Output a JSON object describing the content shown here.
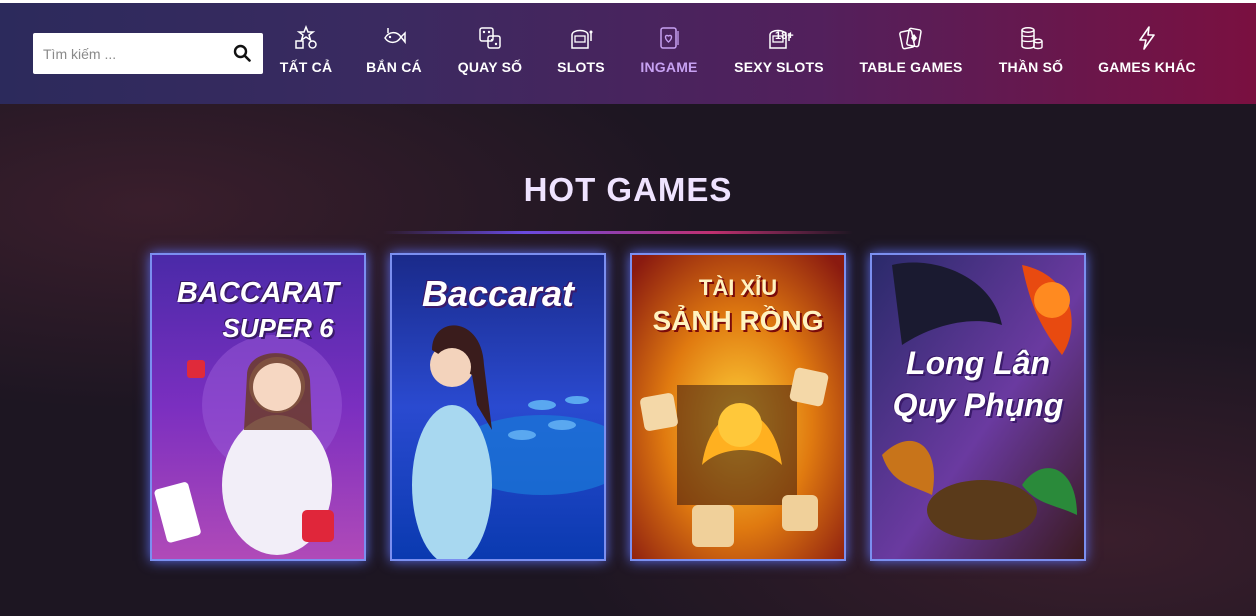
{
  "search": {
    "placeholder": "Tìm kiếm ..."
  },
  "nav": {
    "items": [
      {
        "label": "TẤT CẢ",
        "icon": "shapes-icon"
      },
      {
        "label": "BẮN CÁ",
        "icon": "fish-icon"
      },
      {
        "label": "QUAY SỐ",
        "icon": "dice-icon"
      },
      {
        "label": "SLOTS",
        "icon": "slot-machine-icon"
      },
      {
        "label": "INGAME",
        "icon": "card-heart-icon",
        "active": true
      },
      {
        "label": "SEXY SLOTS",
        "icon": "slot-18-icon",
        "badge": "18+"
      },
      {
        "label": "TABLE GAMES",
        "icon": "playing-cards-icon"
      },
      {
        "label": "THẦN SỐ",
        "icon": "coin-stack-icon"
      },
      {
        "label": "GAMES KHÁC",
        "icon": "lightning-icon"
      }
    ],
    "active_color": "#c7a1f2"
  },
  "hot_games": {
    "title": "HOT GAMES",
    "games": [
      {
        "title_line1": "BACCARAT",
        "title_line2": "SUPER 6"
      },
      {
        "title_line1": "Baccarat"
      },
      {
        "title_line1": "TÀI XỈU",
        "title_line2": "SẢNH RỒNG"
      },
      {
        "title_line1": "Long Lân",
        "title_line2": "Quy Phụng"
      }
    ]
  }
}
